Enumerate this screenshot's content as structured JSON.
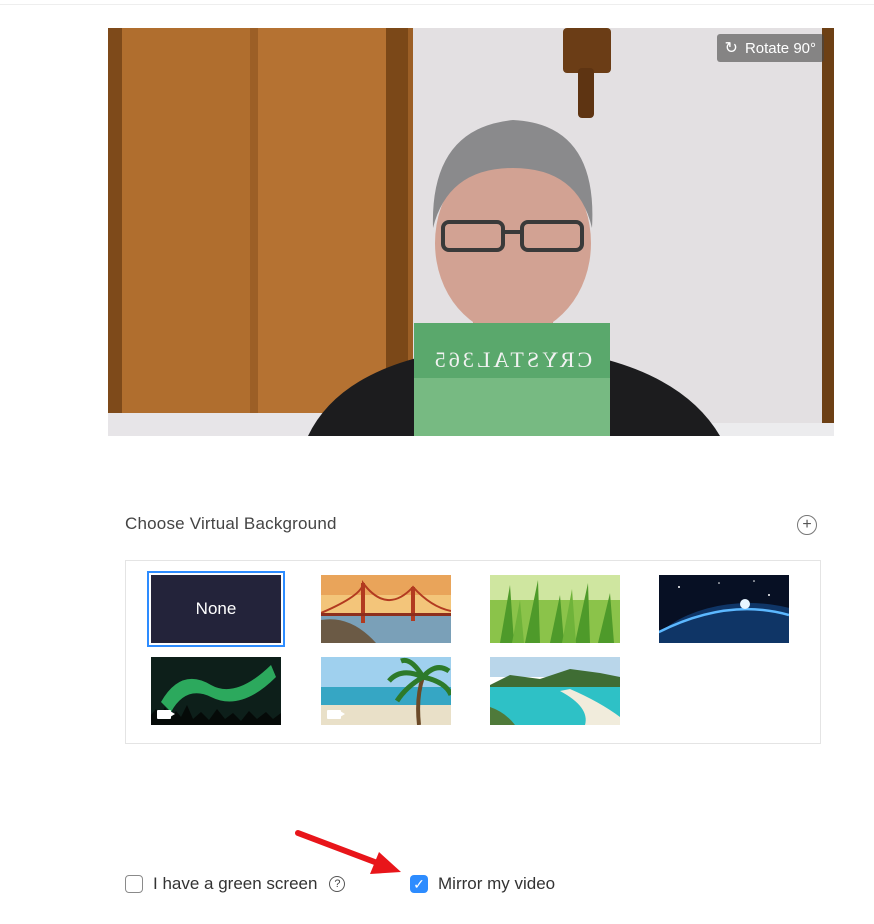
{
  "video": {
    "rotate_label": "Rotate 90°",
    "rotate_icon": "rotate-icon",
    "book_title": "CRYSTAL365"
  },
  "virtual_background": {
    "title": "Choose Virtual Background",
    "add_icon": "plus-circle-icon",
    "items": [
      {
        "label": "None",
        "selected": true
      },
      {
        "label": "",
        "scene": "golden-gate-bridge"
      },
      {
        "label": "",
        "scene": "grass"
      },
      {
        "label": "",
        "scene": "earth-from-space"
      },
      {
        "label": "",
        "scene": "aurora",
        "type": "video"
      },
      {
        "label": "",
        "scene": "beach-palm",
        "type": "video"
      },
      {
        "label": "",
        "scene": "tropical-coast"
      }
    ]
  },
  "options": {
    "green_screen": {
      "label": "I have a green screen",
      "checked": false,
      "help_icon": "question-circle-icon"
    },
    "mirror": {
      "label": "Mirror my video",
      "checked": true
    }
  },
  "colors": {
    "accent": "#2d8cff",
    "none_bg": "#23233a",
    "arrow": "#e8151a"
  }
}
